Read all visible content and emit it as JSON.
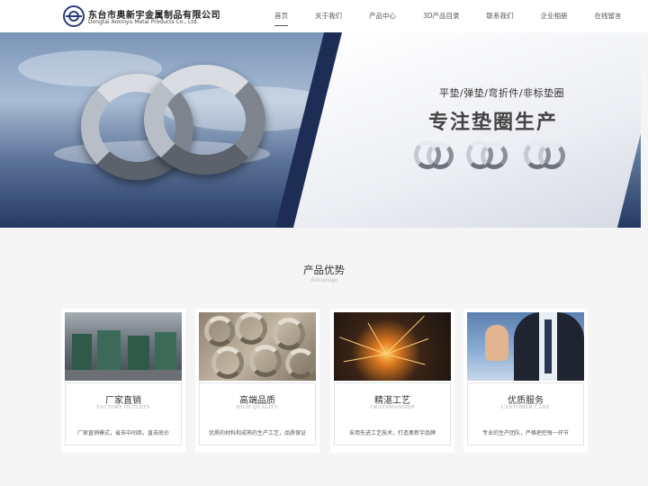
{
  "header": {
    "company_cn": "东台市奥新宇金属制品有限公司",
    "company_en": "Dongtai Aoxinyu Metal Products Co., Ltd."
  },
  "nav": {
    "items": [
      {
        "label": "首页",
        "active": true
      },
      {
        "label": "关于我们",
        "active": false
      },
      {
        "label": "产品中心",
        "active": false
      },
      {
        "label": "3D产品目录",
        "active": false
      },
      {
        "label": "联系我们",
        "active": false
      },
      {
        "label": "企业相册",
        "active": false
      },
      {
        "label": "在线留言",
        "active": false
      }
    ]
  },
  "banner": {
    "subtitle": "平垫/弹垫/弯折件/非标垫圈",
    "title": "专注垫圈生产",
    "slides": 2,
    "active_slide": 2
  },
  "advantage": {
    "title": "产品优势",
    "subtitle": "Advantage",
    "cards": [
      {
        "title": "厂家直销",
        "en": "FACTORY OUTLETS",
        "desc": "厂家直销模式，省去中间商，直击底价",
        "image": "factory-machines"
      },
      {
        "title": "高端品质",
        "en": "HIGH QUALITY",
        "desc": "优质的材料和成熟的生产工艺，品质保证",
        "image": "metal-washers"
      },
      {
        "title": "精湛工艺",
        "en": "CRAFSMANSHIP",
        "desc": "采用先进工艺技术，打造奥新宇品牌",
        "image": "welding-sparks"
      },
      {
        "title": "优质服务",
        "en": "CUSTOMER CARE",
        "desc": "专业的生产团队，严格把控每一环节",
        "image": "thumbs-up-businessman"
      }
    ]
  },
  "colors": {
    "brand": "#2b3d7a",
    "banner_dark": "#1d2d55",
    "page_bg": "#f5f5f5"
  }
}
